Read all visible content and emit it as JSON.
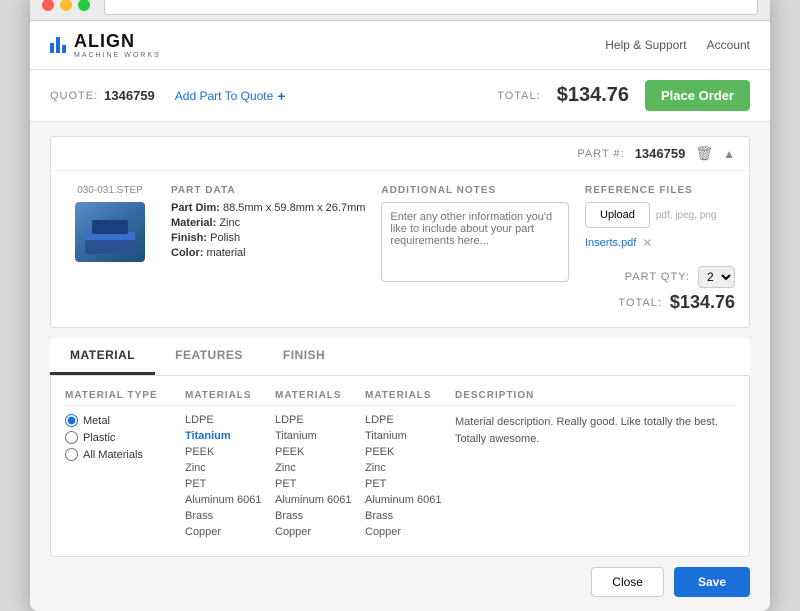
{
  "window": {
    "title": "Align Machine Works"
  },
  "nav": {
    "logo_title": "ALIGN",
    "logo_sub": "MACHINE WORKS",
    "links": [
      "Help & Support",
      "Account"
    ]
  },
  "quote_bar": {
    "quote_label": "QUOTE:",
    "quote_number": "1346759",
    "add_part_label": "Add Part To Quote",
    "total_label": "TOTAL:",
    "total_amount": "$134.76",
    "place_order_label": "Place Order"
  },
  "part": {
    "part_num_label": "PART #:",
    "part_number": "1346759",
    "filename": "030-031.STEP",
    "data_title": "PART DATA",
    "dim_label": "Part Dim:",
    "dim_value": "88.5mm x 59.8mm x 26.7mm",
    "material_label": "Material:",
    "material_value": "Zinc",
    "finish_label": "Finish:",
    "finish_value": "Polish",
    "color_label": "Color:",
    "color_value": "material",
    "notes_title": "ADDITIONAL NOTES",
    "notes_placeholder": "Enter any other information you'd like to include about your part requirements here...",
    "ref_title": "REFERENCE FILES",
    "upload_label": "Upload",
    "file_types": "pdf, jpeg, png",
    "ref_file": "Inserts.pdf",
    "qty_label": "PART QTY:",
    "qty_value": "2",
    "total_label": "TOTAL:",
    "total_value": "$134.76"
  },
  "tabs": {
    "items": [
      {
        "label": "MATERIAL",
        "active": true
      },
      {
        "label": "FEATURES",
        "active": false
      },
      {
        "label": "FINISH",
        "active": false
      }
    ]
  },
  "material_panel": {
    "col_material_type": "MATERIAL TYPE",
    "col_materials1": "MATERIALS",
    "col_materials2": "MATERIALS",
    "col_materials3": "MATERIALS",
    "col_description": "DESCRIPTION",
    "types": [
      "Metal",
      "Plastic",
      "All Materials"
    ],
    "selected_type": "Metal",
    "materials_col1": [
      "LDPE",
      "Titanium",
      "PEEK",
      "Zinc",
      "PET",
      "Aluminum 6061",
      "Brass",
      "Copper"
    ],
    "materials_col2": [
      "LDPE",
      "Titanium",
      "PEEK",
      "Zinc",
      "PET",
      "Aluminum 6061",
      "Brass",
      "Copper"
    ],
    "materials_col3": [
      "LDPE",
      "Titanium",
      "PEEK",
      "Zinc",
      "PET",
      "Aluminum 6061",
      "Brass",
      "Copper"
    ],
    "selected_material": "Titanium",
    "description": "Material description. Really good. Like totally the best. Totally awesome."
  },
  "footer": {
    "close_label": "Close",
    "save_label": "Save"
  }
}
